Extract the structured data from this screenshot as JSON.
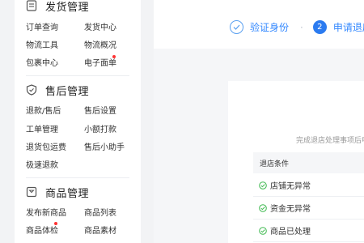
{
  "sidebar": {
    "sections": [
      {
        "title": "发货管理",
        "icon": "document-icon",
        "items": [
          "订单查询",
          "发货中心",
          "物流工具",
          "物流概况",
          "包裹中心",
          "电子面单"
        ]
      },
      {
        "title": "售后管理",
        "icon": "shield-check-icon",
        "items": [
          "退款/售后",
          "售后设置",
          "工单管理",
          "小额打款",
          "退货包运费",
          "售后小助手",
          "极速退款"
        ]
      },
      {
        "title": "商品管理",
        "icon": "box-icon",
        "items": [
          "发布新商品",
          "商品列表",
          "商品体检",
          "商品素材"
        ]
      }
    ]
  },
  "steps": {
    "step1_label": "验证身份",
    "step2_number": "2",
    "step2_label": "申请退店",
    "separator": "·"
  },
  "content": {
    "hint": "完成退店处理事项后申请",
    "table_header": "退店条件",
    "conditions": [
      "店铺无异常",
      "资金无异常",
      "商品已处理"
    ]
  },
  "colors": {
    "accent": "#2b7bf0",
    "success": "#3fb950",
    "badge_dot": "#ff3333"
  }
}
